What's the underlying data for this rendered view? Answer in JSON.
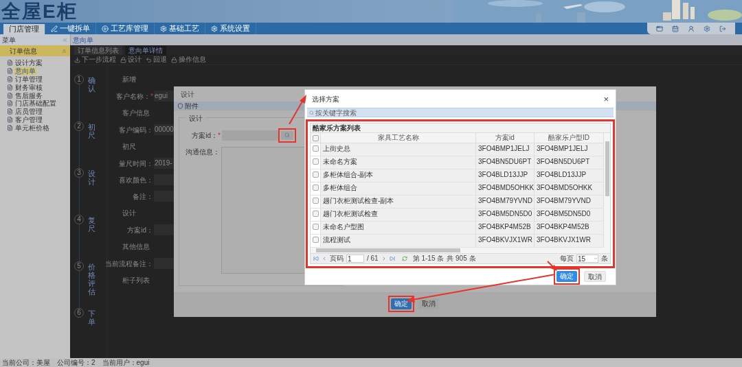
{
  "header": {
    "logo": "全屋E柜"
  },
  "nav_tabs": [
    {
      "label": "门店管理",
      "selected": true,
      "kind": "text"
    },
    {
      "label": "一键拆单",
      "selected": false,
      "kind": "icon"
    },
    {
      "label": "工艺库管理",
      "selected": false,
      "kind": "icon"
    },
    {
      "label": "基础工艺",
      "selected": false,
      "kind": "icon"
    },
    {
      "label": "系统设置",
      "selected": false,
      "kind": "icon"
    }
  ],
  "sidebar": {
    "title": "菜单",
    "group": {
      "label": "订单信息",
      "expanded": true,
      "items": [
        {
          "label": "设计方案",
          "selected": false
        },
        {
          "label": "意向单",
          "selected": true
        },
        {
          "label": "订单管理",
          "selected": false
        },
        {
          "label": "财务审核",
          "selected": false
        },
        {
          "label": "售后服务",
          "selected": false
        },
        {
          "label": "门店基础配置",
          "selected": false
        },
        {
          "label": "店员管理",
          "selected": false
        },
        {
          "label": "客户管理",
          "selected": false
        },
        {
          "label": "单元柜价格",
          "selected": false
        }
      ]
    }
  },
  "breadcrumb": "意向单",
  "content_tabs": [
    {
      "label": "订单信息列表",
      "selected": false
    },
    {
      "label": "意向单详情",
      "selected": true
    }
  ],
  "actions": [
    "下一步流程",
    "设计",
    "回退",
    "操作信息"
  ],
  "steps": [
    {
      "number": "1",
      "label": "确认"
    },
    {
      "number": "2",
      "label": "初尺"
    },
    {
      "number": "3",
      "label": "设计"
    },
    {
      "number": "4",
      "label": "复尺"
    },
    {
      "number": "5",
      "label": "价格评估"
    },
    {
      "number": "6",
      "label": "下单"
    }
  ],
  "form": [
    {
      "kind": "section",
      "label": "新增"
    },
    {
      "kind": "field",
      "label": "客户名称：",
      "required_mark": "*",
      "value": "egui"
    },
    {
      "kind": "section",
      "label": "客户信息"
    },
    {
      "kind": "field",
      "label": "客户编码：",
      "value": "00000"
    },
    {
      "kind": "section",
      "label": "初尺"
    },
    {
      "kind": "field",
      "label": "量尺时间：",
      "value": "2019-"
    },
    {
      "kind": "field",
      "label": "喜欢颜色："
    },
    {
      "kind": "field",
      "label": "备注："
    },
    {
      "kind": "section",
      "label": "设计"
    },
    {
      "kind": "field",
      "label": "方案id："
    },
    {
      "kind": "section",
      "label": "其他信息"
    },
    {
      "kind": "field",
      "label": "当前流程备注："
    },
    {
      "kind": "section",
      "label": "柜子列表"
    }
  ],
  "design_dialog": {
    "title": "设计",
    "tab": "附件",
    "legend": "设计",
    "fields": [
      {
        "kind": "lookup",
        "label": "方案id：",
        "required_mark": "*",
        "highlighted": true
      },
      {
        "kind": "textarea",
        "label": "沟通信息："
      }
    ],
    "buttons": [
      {
        "label": "确定",
        "kind": "primary",
        "highlighted": true
      },
      {
        "label": "取消",
        "kind": "secondary",
        "highlighted": false
      }
    ]
  },
  "picker_dialog": {
    "title": "选择方案",
    "close": "×",
    "search": {
      "placeholder": "按关键字搜索"
    },
    "grid_title": "酷家乐方案列表",
    "highlighted": true,
    "columns": [
      "家具工艺名称",
      "方案id",
      "酷家乐户型ID"
    ],
    "header_checked": false,
    "rows": [
      {
        "cells": [
          "上街史总",
          "3FO4BMP1JELJ",
          "3FO4BMP1JELJ"
        ],
        "checked": false
      },
      {
        "cells": [
          "未命名方案",
          "3FO4BN5DU6PT",
          "3FO4BN5DU6PT"
        ],
        "checked": false
      },
      {
        "cells": [
          "多柜体组合-副本",
          "3FO4BLD13JJP",
          "3FO4BLD13JJP"
        ],
        "checked": false
      },
      {
        "cells": [
          "多柜体组合",
          "3FO4BMD5OHKK",
          "3FO4BMD5OHKK"
        ],
        "checked": false
      },
      {
        "cells": [
          "趟门衣柜测试检查-副本",
          "3FO4BM79YVND",
          "3FO4BM79YVND"
        ],
        "checked": false
      },
      {
        "cells": [
          "趟门衣柜测试检查",
          "3FO4BM5DN5D0",
          "3FO4BM5DN5D0"
        ],
        "checked": false
      },
      {
        "cells": [
          "未命名户型图",
          "3FO4BKP4M52B",
          "3FO4BKP4M52B"
        ],
        "checked": false
      },
      {
        "cells": [
          "流程测试",
          "3FO4BKVJX1WR",
          "3FO4BKVJX1WR"
        ],
        "checked": false
      }
    ],
    "pager": {
      "page_label": "页码",
      "page": "1",
      "total_pages": "/ 61",
      "range": "第 1-15 条",
      "total": "共 905 条",
      "per_page_label": "每页",
      "per_page": "15",
      "unit": "条"
    },
    "buttons": [
      {
        "label": "确定",
        "kind": "primary",
        "highlighted": true
      },
      {
        "label": "取消",
        "kind": "secondary",
        "highlighted": false
      }
    ]
  },
  "status_bar": [
    "当前公司：美屋",
    "公司编号：2",
    "当前用户：egui"
  ]
}
